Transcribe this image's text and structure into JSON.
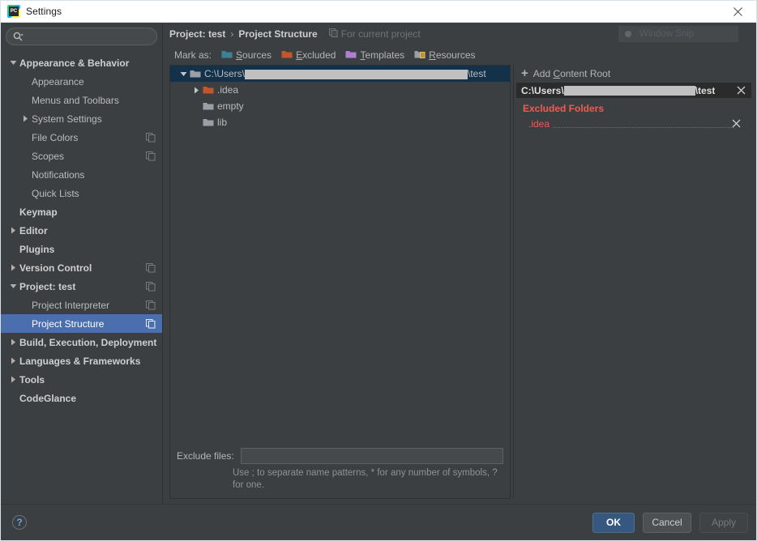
{
  "window": {
    "title": "Settings",
    "app_icon": "pycharm-icon",
    "close_icon": "close-icon"
  },
  "sidebar": {
    "search": {
      "placeholder": "",
      "value": "",
      "icon": "search-icon"
    },
    "items": [
      {
        "label": "Appearance & Behavior",
        "level": 0,
        "bold": true,
        "arrow": "down",
        "copy": false
      },
      {
        "label": "Appearance",
        "level": 1,
        "bold": false,
        "arrow": "none",
        "copy": false
      },
      {
        "label": "Menus and Toolbars",
        "level": 1,
        "bold": false,
        "arrow": "none",
        "copy": false
      },
      {
        "label": "System Settings",
        "level": 1,
        "bold": false,
        "arrow": "right",
        "copy": false
      },
      {
        "label": "File Colors",
        "level": 1,
        "bold": false,
        "arrow": "none",
        "copy": true
      },
      {
        "label": "Scopes",
        "level": 1,
        "bold": false,
        "arrow": "none",
        "copy": true
      },
      {
        "label": "Notifications",
        "level": 1,
        "bold": false,
        "arrow": "none",
        "copy": false
      },
      {
        "label": "Quick Lists",
        "level": 1,
        "bold": false,
        "arrow": "none",
        "copy": false
      },
      {
        "label": "Keymap",
        "level": 0,
        "bold": true,
        "arrow": "none",
        "copy": false
      },
      {
        "label": "Editor",
        "level": 0,
        "bold": true,
        "arrow": "right",
        "copy": false
      },
      {
        "label": "Plugins",
        "level": 0,
        "bold": true,
        "arrow": "none",
        "copy": false
      },
      {
        "label": "Version Control",
        "level": 0,
        "bold": true,
        "arrow": "right",
        "copy": true
      },
      {
        "label": "Project: test",
        "level": 0,
        "bold": true,
        "arrow": "down",
        "copy": true
      },
      {
        "label": "Project Interpreter",
        "level": 1,
        "bold": false,
        "arrow": "none",
        "copy": true
      },
      {
        "label": "Project Structure",
        "level": 1,
        "bold": false,
        "arrow": "none",
        "copy": true,
        "selected": true
      },
      {
        "label": "Build, Execution, Deployment",
        "level": 0,
        "bold": true,
        "arrow": "right",
        "copy": false
      },
      {
        "label": "Languages & Frameworks",
        "level": 0,
        "bold": true,
        "arrow": "right",
        "copy": false
      },
      {
        "label": "Tools",
        "level": 0,
        "bold": true,
        "arrow": "right",
        "copy": false
      },
      {
        "label": "CodeGlance",
        "level": 0,
        "bold": true,
        "arrow": "none",
        "copy": false
      }
    ]
  },
  "main": {
    "breadcrumb": {
      "parent": "Project: test",
      "separator": "›",
      "current": "Project Structure"
    },
    "scope_label": "For current project",
    "scope_icon": "copy-icon",
    "window_snip": {
      "label": "Window Snip",
      "icon": "record-dot-icon"
    },
    "mark_as": {
      "lead": "Mark as:",
      "options": [
        {
          "label": "Sources",
          "mnemonic": "S",
          "color": "#3b8296",
          "icon": "folder-icon"
        },
        {
          "label": "Excluded",
          "mnemonic": "E",
          "color": "#c3562a",
          "icon": "folder-icon"
        },
        {
          "label": "Templates",
          "mnemonic": "T",
          "color": "#a islaman",
          "icon": "folder-icon"
        },
        {
          "label": "Resources",
          "mnemonic": "R",
          "color": "#9aa0a6",
          "icon": "folder-resource-icon"
        }
      ]
    },
    "file_tree": [
      {
        "label_prefix": "C:\\Users\\",
        "redacted": true,
        "label_suffix": "\\test",
        "level": 0,
        "arrow": "down",
        "folder_color": "#9aa0a6",
        "selected": true
      },
      {
        "label_prefix": ".idea",
        "redacted": false,
        "label_suffix": "",
        "level": 1,
        "arrow": "right",
        "folder_color": "#c3562a",
        "selected": false
      },
      {
        "label_prefix": "empty",
        "redacted": false,
        "label_suffix": "",
        "level": 1,
        "arrow": "none",
        "folder_color": "#9aa0a6",
        "selected": false
      },
      {
        "label_prefix": "lib",
        "redacted": false,
        "label_suffix": "",
        "level": 1,
        "arrow": "none",
        "folder_color": "#9aa0a6",
        "selected": false
      }
    ],
    "exclude_files": {
      "label": "Exclude files:",
      "value": "",
      "placeholder": "",
      "hint": "Use ; to separate name patterns, * for any number of symbols, ? for one."
    }
  },
  "right_panel": {
    "add_content_root": {
      "label": "Add Content Root",
      "mnemonic": "C",
      "icon": "plus-icon"
    },
    "content_root": {
      "prefix": "C:\\Users\\",
      "redacted": true,
      "suffix": "\\test",
      "remove_icon": "close-icon"
    },
    "excluded_folders": {
      "title": "Excluded Folders",
      "color": "#f05a54",
      "items": [
        {
          "label": ".idea",
          "remove_icon": "close-icon"
        }
      ]
    }
  },
  "footer": {
    "help": {
      "label": "?",
      "icon": "help-icon"
    },
    "ok": "OK",
    "cancel": "Cancel",
    "apply": "Apply"
  },
  "colors": {
    "window_bg": "#3c3f41",
    "accent": "#4b6eaf",
    "selection_tree": "#14314a",
    "error": "#f05a54",
    "ok_button": "#365880"
  }
}
